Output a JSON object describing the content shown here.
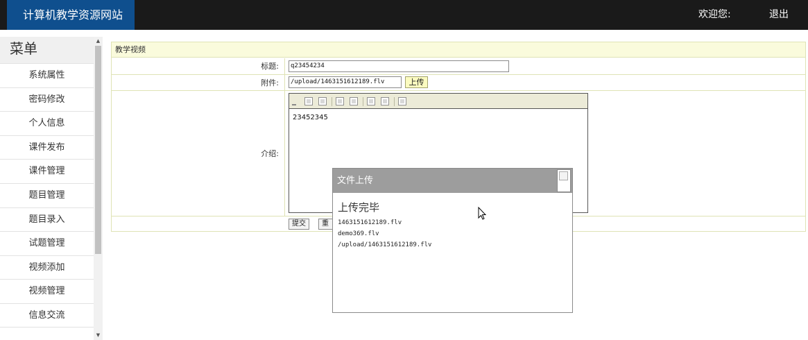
{
  "header": {
    "site_title": "计算机教学资源网站",
    "welcome": "欢迎您:",
    "logout": "退出"
  },
  "sidebar": {
    "title": "菜单",
    "items": [
      "系统属性",
      "密码修改",
      "个人信息",
      "课件发布",
      "课件管理",
      "题目管理",
      "题目录入",
      "试题管理",
      "视频添加",
      "视频管理",
      "信息交流"
    ]
  },
  "form": {
    "section_title": "教学视频",
    "title_label": "标题:",
    "title_value": "q23454234",
    "attachment_label": "附件:",
    "attachment_value": "/upload/1463151612189.flv",
    "upload_button": "上传",
    "intro_label": "介绍:",
    "editor_content": "23452345",
    "submit_button": "提交",
    "reset_button": "重置"
  },
  "dialog": {
    "title": "文件上传",
    "status": "上传完毕",
    "lines": [
      "1463151612189.flv",
      "demo369.flv",
      "/upload/1463151612189.flv"
    ]
  },
  "editor_icons": [
    "format-icon",
    "format-icon",
    "align-icon",
    "align-icon",
    "insert-icon",
    "insert-icon",
    "image-icon"
  ],
  "colors": {
    "header_bg": "#1a1a1a",
    "brand_bg": "#0f4f8e",
    "form_header_bg": "#fafbdc",
    "dialog_header_bg": "#9d9d9d"
  }
}
